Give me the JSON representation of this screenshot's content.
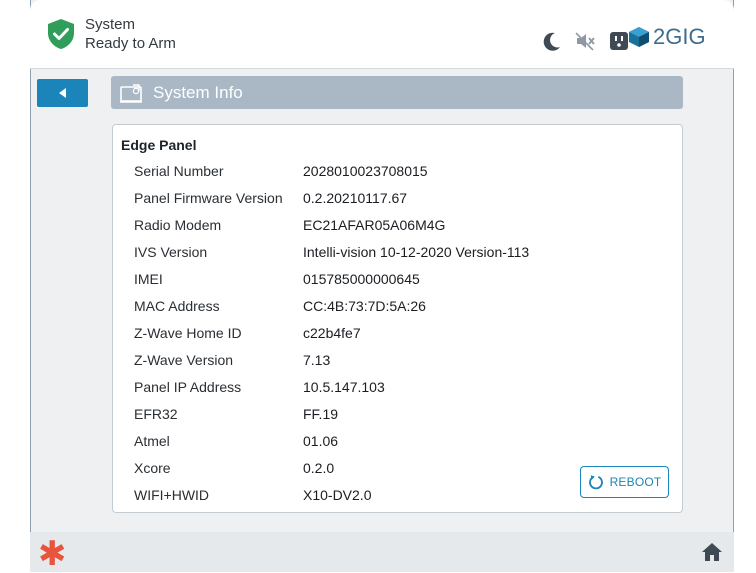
{
  "header": {
    "status_line1": "System",
    "status_line2": "Ready to Arm",
    "brand": "2GIG",
    "icons": [
      "night-mode-icon",
      "mute-icon",
      "outlet-icon"
    ],
    "status_color": "#2f9e5a"
  },
  "page": {
    "title": "System Info",
    "back_icon": "back-arrow-icon"
  },
  "panel": {
    "title": "Edge Panel",
    "rows": [
      {
        "label": "Serial Number",
        "value": "2028010023708015"
      },
      {
        "label": "Panel Firmware Version",
        "value": "0.2.20210117.67"
      },
      {
        "label": "Radio Modem",
        "value": "EC21AFAR05A06M4G"
      },
      {
        "label": "IVS Version",
        "value": "Intelli-vision 10-12-2020 Version-113"
      },
      {
        "label": "IMEI",
        "value": "015785000000645"
      },
      {
        "label": "MAC Address",
        "value": "CC:4B:73:7D:5A:26"
      },
      {
        "label": "Z-Wave Home ID",
        "value": "c22b4fe7"
      },
      {
        "label": "Z-Wave Version",
        "value": "7.13"
      },
      {
        "label": "Panel IP Address",
        "value": "10.5.147.103"
      },
      {
        "label": "EFR32",
        "value": "FF.19"
      },
      {
        "label": "Atmel",
        "value": "01.06"
      },
      {
        "label": "Xcore",
        "value": "0.2.0"
      },
      {
        "label": "WIFI+HWID",
        "value": "X10-DV2.0"
      }
    ],
    "reboot_label": "REBOOT"
  },
  "footer": {
    "emergency_symbol": "✱",
    "home_icon": "home-icon"
  },
  "colors": {
    "accent": "#1b84b8",
    "title_bar": "#aab8c5",
    "emergency": "#e8553e"
  }
}
